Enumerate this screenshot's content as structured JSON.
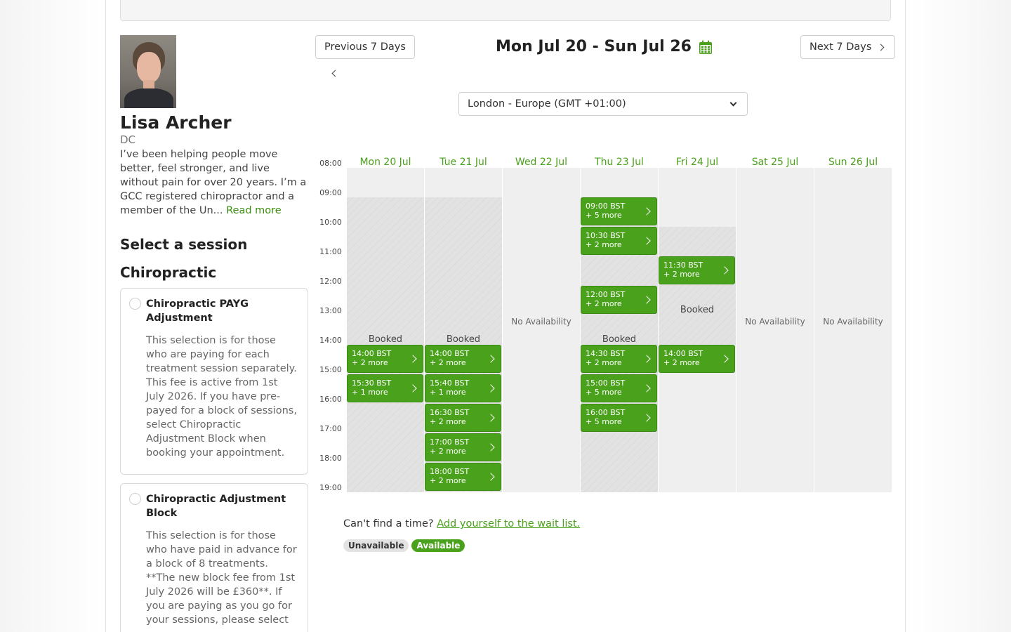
{
  "practitioner": {
    "name": "Lisa Archer",
    "credentials": "DC",
    "bio": "I’ve been helping people move better, feel stronger, and live without pain for over 20 years. I’m a GCC registered chiropractor and a member of the Un...",
    "read_more": "Read more"
  },
  "sessions": {
    "heading": "Select a session",
    "group": "Chiropractic",
    "items": [
      {
        "title": "Chiropractic PAYG Adjustment",
        "desc": "This selection is for those who are paying for each treatment session separately. This fee is active from 1st July 2026. If you have pre-payed for a block of sessions, select Chiropractic Adjustment Block when booking your appointment."
      },
      {
        "title": "Chiropractic Adjustment Block",
        "desc": "This selection is for those who have paid in advance for a block of 8 treatments. **The new block fee from 1st July 2026 will be £360**. If you are paying as you go for your sessions, please select"
      }
    ]
  },
  "nav": {
    "prev": "Previous 7 Days",
    "next": "Next 7 Days",
    "week_title": "Mon Jul 20 - Sun Jul 26",
    "calendar_icon": "calendar-icon"
  },
  "timezone": {
    "selected": "London - Europe (GMT +01:00)"
  },
  "calendar": {
    "hours": [
      "08:00",
      "09:00",
      "10:00",
      "11:00",
      "12:00",
      "13:00",
      "14:00",
      "15:00",
      "16:00",
      "17:00",
      "18:00",
      "19:00"
    ],
    "days": [
      {
        "label": "Mon 20 Jul",
        "status": "Booked",
        "slots": [
          {
            "time": "14:00 BST",
            "more": "+ 2 more"
          },
          {
            "time": "15:30 BST",
            "more": "+ 1 more"
          }
        ]
      },
      {
        "label": "Tue 21 Jul",
        "status": "Booked",
        "slots": [
          {
            "time": "14:00 BST",
            "more": "+ 2 more"
          },
          {
            "time": "15:40 BST",
            "more": "+ 1 more"
          },
          {
            "time": "16:30 BST",
            "more": "+ 2 more"
          },
          {
            "time": "17:00 BST",
            "more": "+ 2 more"
          },
          {
            "time": "18:00 BST",
            "more": "+ 2 more"
          }
        ]
      },
      {
        "label": "Wed 22 Jul",
        "status": "No Availability",
        "slots": []
      },
      {
        "label": "Thu 23 Jul",
        "status": "Booked",
        "slots": [
          {
            "time": "09:00 BST",
            "more": "+ 5 more"
          },
          {
            "time": "10:30 BST",
            "more": "+ 2 more"
          },
          {
            "time": "12:00 BST",
            "more": "+ 2 more"
          },
          {
            "time": "14:30 BST",
            "more": "+ 2 more"
          },
          {
            "time": "15:00 BST",
            "more": "+ 5 more"
          },
          {
            "time": "16:00 BST",
            "more": "+ 5 more"
          }
        ]
      },
      {
        "label": "Fri 24 Jul",
        "status": "Booked",
        "slots": [
          {
            "time": "11:30 BST",
            "more": "+ 2 more"
          },
          {
            "time": "14:00 BST",
            "more": "+ 2 more"
          }
        ]
      },
      {
        "label": "Sat 25 Jul",
        "status": "No Availability",
        "slots": []
      },
      {
        "label": "Sun 26 Jul",
        "status": "No Availability",
        "slots": []
      }
    ]
  },
  "waitlist": {
    "prompt": "Can't find a time?",
    "link": "Add yourself to the wait list."
  },
  "legend": {
    "unavailable": "Unavailable",
    "available": "Available"
  },
  "colors": {
    "accent": "#4aa11c",
    "blocked": "#e2e2e2",
    "column": "#efefef"
  }
}
